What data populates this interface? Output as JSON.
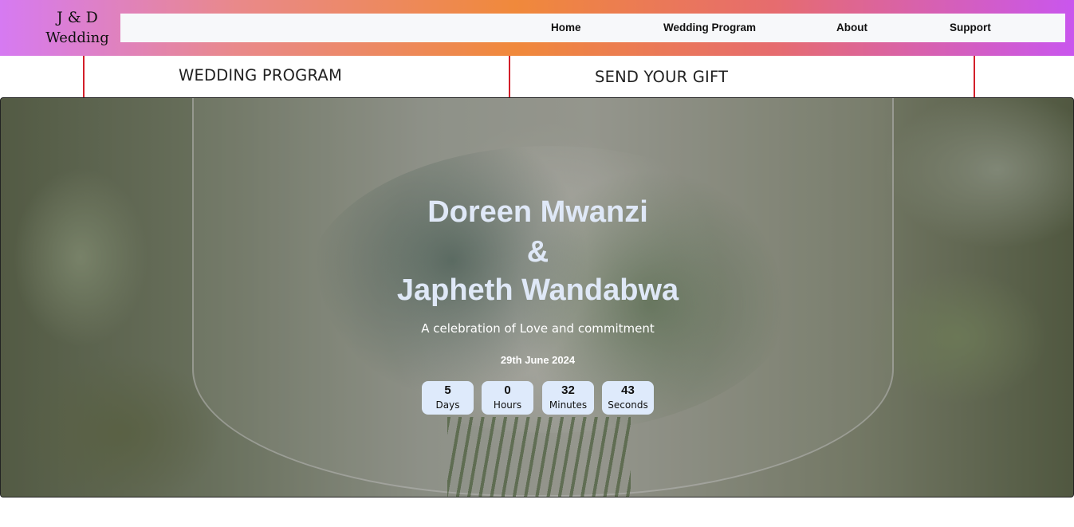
{
  "brand": {
    "line1": "J & D",
    "line2": "Wedding"
  },
  "nav": {
    "home": "Home",
    "program": "Wedding Program",
    "about": "About",
    "support": "Support"
  },
  "tabs": {
    "program": "WEDDING PROGRAM",
    "gift": "SEND YOUR GIFT"
  },
  "hero": {
    "name1": "Doreen Mwanzi",
    "amp": "&",
    "name2": "Japheth Wandabwa",
    "tagline": "A celebration of Love and commitment",
    "date": "29th June 2024",
    "countdown": [
      {
        "value": "5",
        "unit": "Days"
      },
      {
        "value": "0",
        "unit": "Hours"
      },
      {
        "value": "32",
        "unit": "Minutes"
      },
      {
        "value": "43",
        "unit": "Seconds"
      }
    ]
  },
  "colors": {
    "accent_line": "#d31f2a",
    "countdown_bg": "#deeafb",
    "name_text": "#dfe8f7"
  }
}
